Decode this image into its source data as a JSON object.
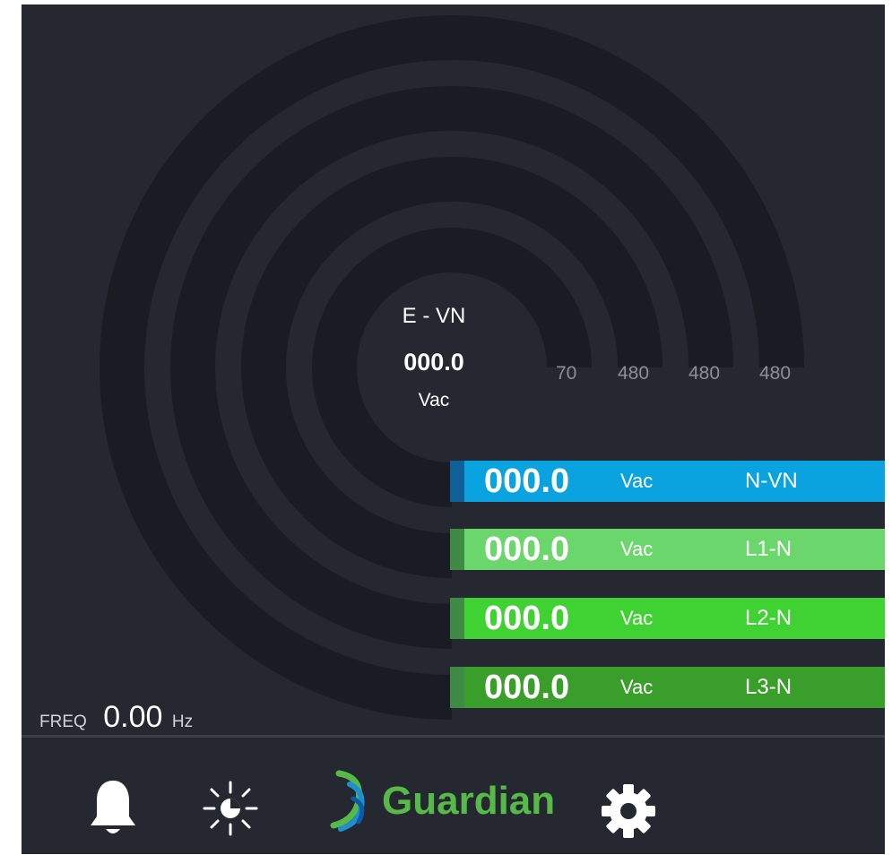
{
  "gauge": {
    "title": "E - VN",
    "value": "000.0",
    "unit": "Vac",
    "scale_labels": [
      "70",
      "480",
      "480",
      "480"
    ],
    "rings": 4,
    "ring_color": "#1a1c23"
  },
  "phases": [
    {
      "value": "000.0",
      "unit": "Vac",
      "name": "N-VN",
      "color": "#0aa3df",
      "edge": "#0f5f98"
    },
    {
      "value": "000.0",
      "unit": "Vac",
      "name": "L1-N",
      "color": "#6bd66b",
      "edge": "#3f8a45"
    },
    {
      "value": "000.0",
      "unit": "Vac",
      "name": "L2-N",
      "color": "#3fd232",
      "edge": "#3f8a45"
    },
    {
      "value": "000.0",
      "unit": "Vac",
      "name": "L3-N",
      "color": "#3a9f2a",
      "edge": "#3f8a45"
    }
  ],
  "frequency": {
    "label": "FREQ",
    "value": "0.00",
    "unit": "Hz"
  },
  "toolbar": {
    "alarm_icon": "bell-icon",
    "brightness_icon": "sun-icon",
    "logo_text": "Guardian",
    "settings_icon": "gear-icon"
  },
  "colors": {
    "background": "#252830",
    "logo_green": "#56b948",
    "logo_blue": "#1f8fd1"
  }
}
